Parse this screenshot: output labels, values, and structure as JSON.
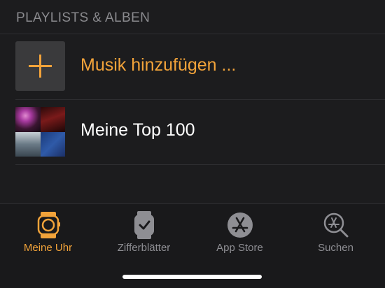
{
  "section": {
    "title": "PLAYLISTS & ALBEN"
  },
  "list": {
    "items": [
      {
        "label": "Musik hinzufügen ...",
        "icon": "plus-icon"
      },
      {
        "label": "Meine Top 100",
        "icon": "playlist-artwork"
      }
    ]
  },
  "tabbar": {
    "tabs": [
      {
        "label": "Meine Uhr",
        "icon": "watch-icon",
        "active": true
      },
      {
        "label": "Zifferblätter",
        "icon": "watch-face-icon",
        "active": false
      },
      {
        "label": "App Store",
        "icon": "app-store-icon",
        "active": false
      },
      {
        "label": "Suchen",
        "icon": "search-icon",
        "active": false
      }
    ]
  },
  "colors": {
    "background": "#1c1c1e",
    "accent": "#f2a33a",
    "inactive": "#8e8e93",
    "separator": "#2e2e31"
  }
}
